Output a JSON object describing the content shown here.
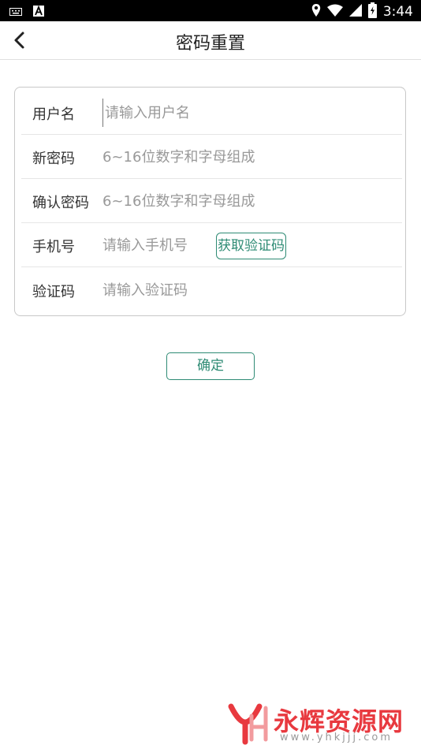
{
  "status_bar": {
    "time": "3:44",
    "icons": [
      "keyboard-icon",
      "a-notification-icon",
      "location-icon",
      "wifi-icon",
      "signal-icon",
      "battery-icon"
    ]
  },
  "navbar": {
    "title": "密码重置",
    "back_icon": "chevron-left-icon"
  },
  "form": {
    "rows": [
      {
        "label": "用户名",
        "placeholder": "请输入用户名"
      },
      {
        "label": "新密码",
        "placeholder": "6~16位数字和字母组成"
      },
      {
        "label": "确认密码",
        "placeholder": "6~16位数字和字母组成"
      },
      {
        "label": "手机号",
        "placeholder": "请输入手机号"
      },
      {
        "label": "验证码",
        "placeholder": "请输入验证码"
      }
    ],
    "get_code_label": "获取验证码"
  },
  "confirm_label": "确定",
  "watermark": {
    "text": "永辉资源网",
    "url": "www.yhkjjj.com"
  },
  "colors": {
    "accent": "#2e8b74",
    "watermark_red": "#e8393f",
    "border": "#c8c8c8"
  }
}
